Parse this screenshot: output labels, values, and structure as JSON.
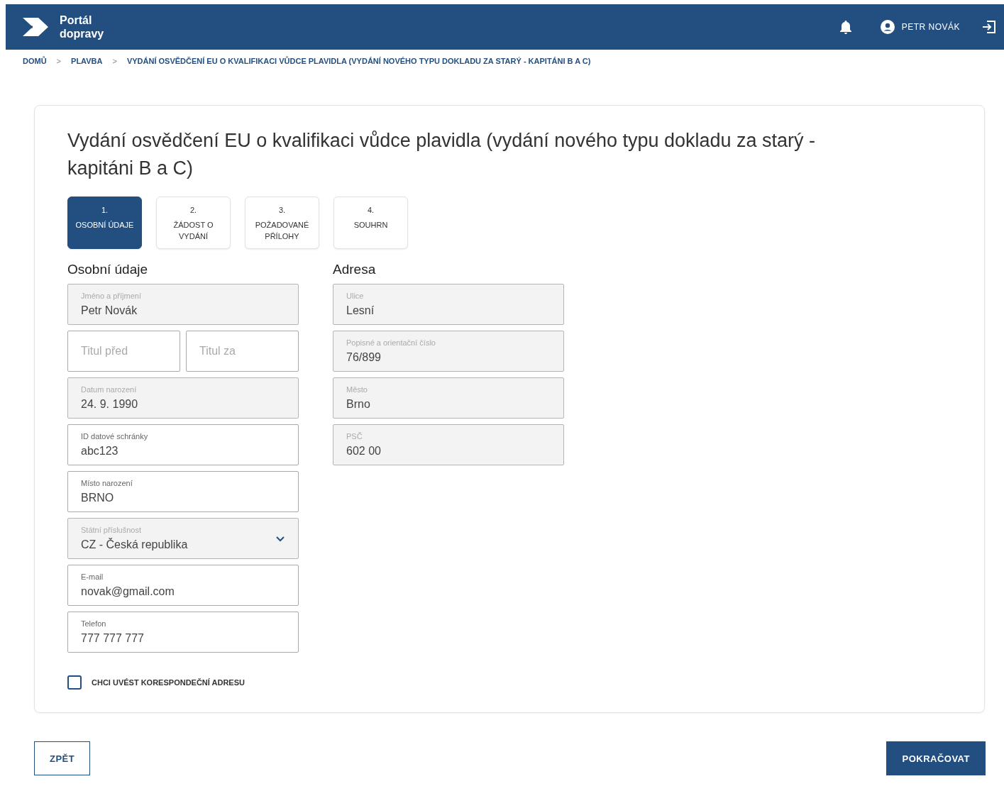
{
  "header": {
    "logo_text": "Portál\ndopravy",
    "user_name": "PETR NOVÁK"
  },
  "breadcrumbs": [
    "DOMŮ",
    "PLAVBA",
    "VYDÁNÍ OSVĚDČENÍ EU O KVALIFIKACI VŮDCE PLAVIDLA (VYDÁNÍ NOVÉHO TYPU DOKLADU ZA STARÝ - KAPITÁNI B A C)"
  ],
  "breadcrumb_separator": ">",
  "title": "Vydání osvědčení EU o kvalifikaci vůdce plavidla (vydání nového typu dokladu za starý - kapitáni B a C)",
  "steps": [
    {
      "number": "1.",
      "label": "OSOBNÍ ÚDAJE",
      "selected": true
    },
    {
      "number": "2.",
      "label": "ŽÁDOST O VYDÁNÍ",
      "selected": false
    },
    {
      "number": "3.",
      "label": "POŽADOVANÉ PŘÍLOHY",
      "selected": false
    },
    {
      "number": "4.",
      "label": "SOUHRN",
      "selected": false
    }
  ],
  "personal": {
    "heading": "Osobní údaje",
    "fields": [
      {
        "kind": "text",
        "label": "Jméno a příjmení",
        "value": "Petr Novák",
        "disabled": true
      },
      {
        "kind": "pair",
        "fields": [
          {
            "kind": "text",
            "placeholder": "Titul před",
            "disabled": false
          },
          {
            "kind": "text",
            "placeholder": "Titul za",
            "disabled": false
          }
        ]
      },
      {
        "kind": "text",
        "label": "Datum narození",
        "value": "24. 9. 1990",
        "disabled": true
      },
      {
        "kind": "text",
        "label": "ID datové schránky",
        "value": "abc123",
        "disabled": false
      },
      {
        "kind": "text",
        "label": "Místo narození",
        "value": "BRNO",
        "disabled": false
      },
      {
        "kind": "select",
        "label": "Státní příslušnost",
        "value": "CZ - Česká republika",
        "disabled": true
      },
      {
        "kind": "text",
        "label": "E-mail",
        "value": "novak@gmail.com",
        "disabled": false
      },
      {
        "kind": "text",
        "label": "Telefon",
        "value": "777 777 777",
        "disabled": false
      }
    ]
  },
  "address": {
    "heading": "Adresa",
    "fields": [
      {
        "kind": "text",
        "label": "Ulice",
        "value": "Lesní",
        "disabled": true
      },
      {
        "kind": "text",
        "label": "Popisné a orientační číslo",
        "value": "76/899",
        "disabled": true
      },
      {
        "kind": "text",
        "label": "Město",
        "value": "Brno",
        "disabled": true
      },
      {
        "kind": "text",
        "label": "PSČ",
        "value": "602 00",
        "disabled": true
      }
    ]
  },
  "correspondence_checkbox": {
    "label": "CHCI UVÉST KORESPONDEČNÍ ADRESU",
    "checked": false
  },
  "buttons": {
    "back": "ZPĚT",
    "continue": "POKRAČOVAT"
  }
}
